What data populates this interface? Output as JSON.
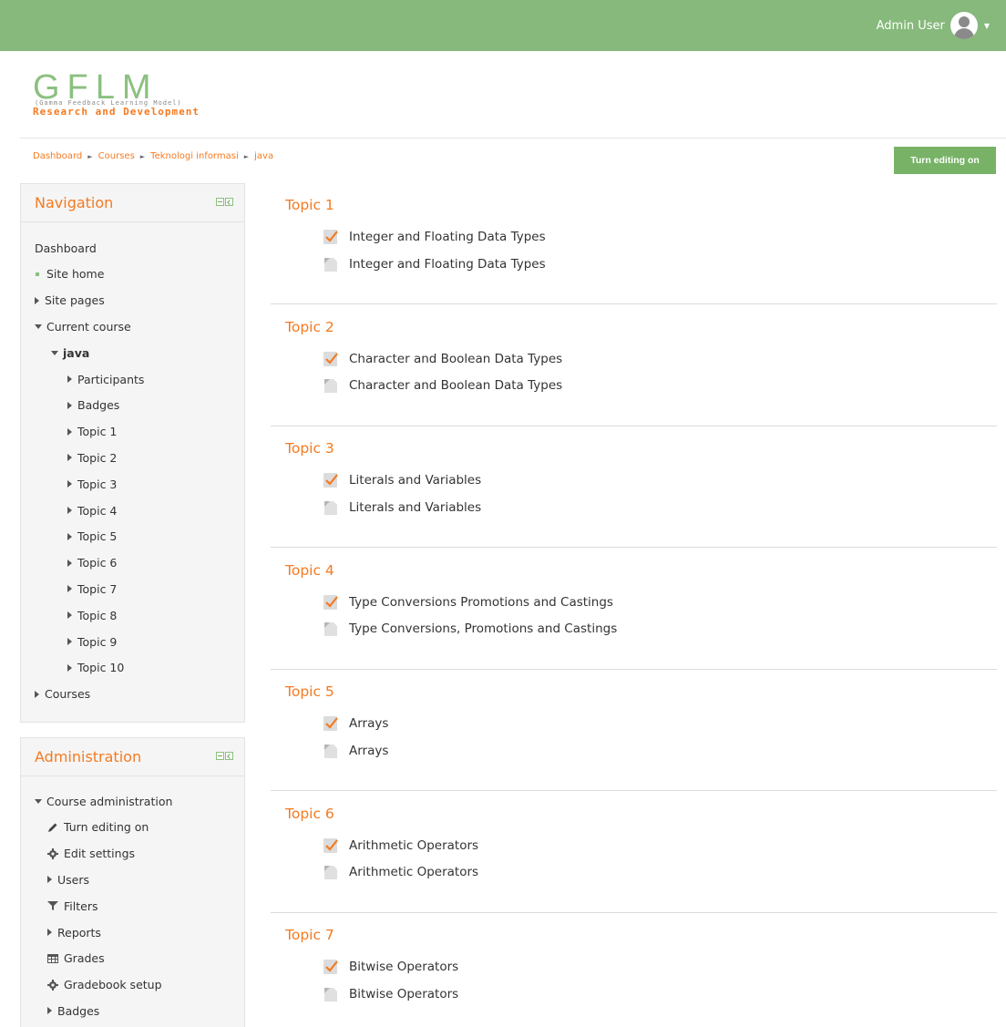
{
  "header": {
    "user_name": "Admin User"
  },
  "logo": {
    "wordmark": "GFLM",
    "subtitle": "(Gamma Feedback Learning Model)",
    "tagline": "Research and Development"
  },
  "breadcrumb": [
    "Dashboard",
    "Courses",
    "Teknologi informasi",
    "java"
  ],
  "edit_button": "Turn editing on",
  "navigation": {
    "title": "Navigation",
    "items": [
      {
        "label": "Dashboard",
        "icon": "none"
      },
      {
        "label": "Site home",
        "icon": "bullet"
      },
      {
        "label": "Site pages",
        "icon": "collapsed"
      },
      {
        "label": "Current course",
        "icon": "expanded"
      },
      {
        "label": "java",
        "icon": "expanded"
      },
      {
        "label": "Participants",
        "icon": "collapsed"
      },
      {
        "label": "Badges",
        "icon": "collapsed"
      },
      {
        "label": "Topic 1",
        "icon": "collapsed"
      },
      {
        "label": "Topic 2",
        "icon": "collapsed"
      },
      {
        "label": "Topic 3",
        "icon": "collapsed"
      },
      {
        "label": "Topic 4",
        "icon": "collapsed"
      },
      {
        "label": "Topic 5",
        "icon": "collapsed"
      },
      {
        "label": "Topic 6",
        "icon": "collapsed"
      },
      {
        "label": "Topic 7",
        "icon": "collapsed"
      },
      {
        "label": "Topic 8",
        "icon": "collapsed"
      },
      {
        "label": "Topic 9",
        "icon": "collapsed"
      },
      {
        "label": "Topic 10",
        "icon": "collapsed"
      },
      {
        "label": "Courses",
        "icon": "collapsed"
      }
    ]
  },
  "administration": {
    "title": "Administration",
    "items": [
      {
        "label": "Course administration",
        "icon": "expanded"
      },
      {
        "label": "Turn editing on",
        "icon": "pencil"
      },
      {
        "label": "Edit settings",
        "icon": "gear"
      },
      {
        "label": "Users",
        "icon": "collapsed"
      },
      {
        "label": "Filters",
        "icon": "filter"
      },
      {
        "label": "Reports",
        "icon": "collapsed"
      },
      {
        "label": "Grades",
        "icon": "table"
      },
      {
        "label": "Gradebook setup",
        "icon": "gear"
      },
      {
        "label": "Badges",
        "icon": "collapsed"
      }
    ]
  },
  "sections": [
    {
      "title": "Topic 1",
      "activities": [
        {
          "label": "Integer and Floating Data Types",
          "icon": "assignment-icon"
        },
        {
          "label": "Integer and Floating Data Types",
          "icon": "file-icon"
        }
      ]
    },
    {
      "title": "Topic 2",
      "activities": [
        {
          "label": "Character and Boolean Data Types",
          "icon": "assignment-icon"
        },
        {
          "label": "Character and Boolean Data Types",
          "icon": "file-icon"
        }
      ]
    },
    {
      "title": "Topic 3",
      "activities": [
        {
          "label": "Literals and Variables",
          "icon": "assignment-icon"
        },
        {
          "label": "Literals and Variables",
          "icon": "file-icon"
        }
      ]
    },
    {
      "title": "Topic 4",
      "activities": [
        {
          "label": "Type Conversions Promotions and Castings",
          "icon": "assignment-icon"
        },
        {
          "label": "Type Conversions, Promotions and Castings",
          "icon": "file-icon"
        }
      ]
    },
    {
      "title": "Topic 5",
      "activities": [
        {
          "label": "Arrays",
          "icon": "assignment-icon"
        },
        {
          "label": "Arrays",
          "icon": "file-icon"
        }
      ]
    },
    {
      "title": "Topic 6",
      "activities": [
        {
          "label": "Arithmetic Operators",
          "icon": "assignment-icon"
        },
        {
          "label": "Arithmetic Operators",
          "icon": "file-icon"
        }
      ]
    },
    {
      "title": "Topic 7",
      "activities": [
        {
          "label": "Bitwise Operators",
          "icon": "assignment-icon"
        },
        {
          "label": "Bitwise Operators",
          "icon": "file-icon"
        }
      ]
    }
  ],
  "colors": {
    "topbar": "#86b97b",
    "accent": "#f47a21",
    "button": "#77b266"
  }
}
